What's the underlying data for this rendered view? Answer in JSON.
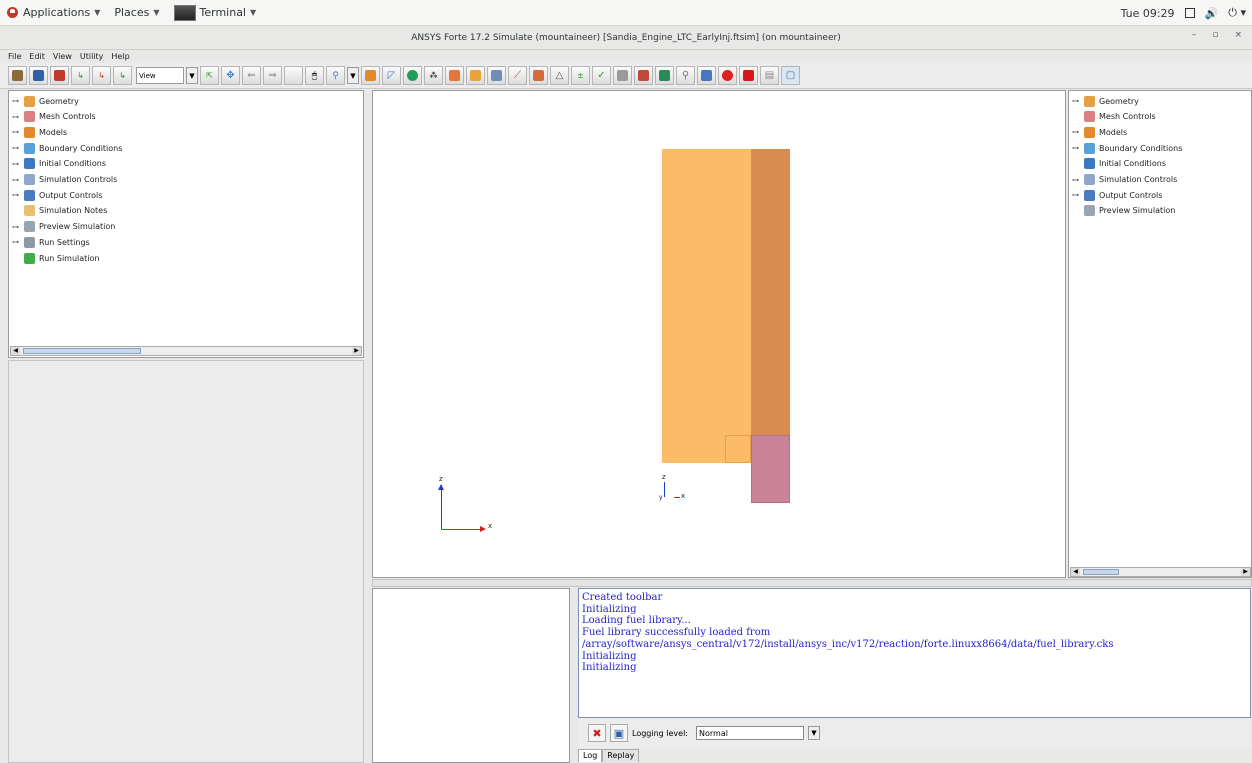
{
  "topbar": {
    "applications": "Applications",
    "places": "Places",
    "terminal": "Terminal",
    "clock": "Tue 09:29"
  },
  "window": {
    "title": "ANSYS Forte 17.2 Simulate (mountaineer)  [Sandia_Engine_LTC_EarlyInj.ftsim] (on mountaineer)"
  },
  "menu": [
    "File",
    "Edit",
    "View",
    "Utility",
    "Help"
  ],
  "toolbar": {
    "view_combo": "View"
  },
  "left_tree": [
    {
      "label": "Geometry",
      "icon_color": "#e6a044",
      "expandable": true
    },
    {
      "label": "Mesh Controls",
      "icon_color": "#d98080",
      "expandable": true
    },
    {
      "label": "Models",
      "icon_color": "#e08a2c",
      "expandable": true
    },
    {
      "label": "Boundary Conditions",
      "icon_color": "#5aa0d8",
      "expandable": true
    },
    {
      "label": "Initial Conditions",
      "icon_color": "#3b78c4",
      "expandable": true
    },
    {
      "label": "Simulation Controls",
      "icon_color": "#8fa7c8",
      "expandable": true
    },
    {
      "label": "Output Controls",
      "icon_color": "#4a7bbf",
      "expandable": true
    },
    {
      "label": "Simulation Notes",
      "icon_color": "#e8c070",
      "expandable": false
    },
    {
      "label": "Preview Simulation",
      "icon_color": "#9aa4b0",
      "expandable": true
    },
    {
      "label": "Run Settings",
      "icon_color": "#8f9aa8",
      "expandable": true
    },
    {
      "label": "Run Simulation",
      "icon_color": "#3fae49",
      "expandable": false
    }
  ],
  "right_tree": [
    {
      "label": "Geometry",
      "icon_color": "#e6a044",
      "expandable": true
    },
    {
      "label": "Mesh Controls",
      "icon_color": "#d98080",
      "expandable": false
    },
    {
      "label": "Models",
      "icon_color": "#e08a2c",
      "expandable": true
    },
    {
      "label": "Boundary Conditions",
      "icon_color": "#5aa0d8",
      "expandable": true
    },
    {
      "label": "Initial Conditions",
      "icon_color": "#3b78c4",
      "expandable": false
    },
    {
      "label": "Simulation Controls",
      "icon_color": "#8fa7c8",
      "expandable": true
    },
    {
      "label": "Output Controls",
      "icon_color": "#4a7bbf",
      "expandable": true
    },
    {
      "label": "Preview Simulation",
      "icon_color": "#9aa4b0",
      "expandable": false
    }
  ],
  "viewport": {
    "axis_z": "z",
    "axis_x": "x",
    "axis_y": "y",
    "colors": {
      "block_light": "#fdbb68",
      "block_dark": "#d98c4f",
      "block_pink": "#c98597"
    }
  },
  "log": {
    "lines": [
      "Created toolbar",
      "Initializing",
      "Loading fuel library...",
      "Fuel library successfully loaded from",
      "/array/software/ansys_central/v172/install/ansys_inc/v172/reaction/forte.linuxx8664/data/fuel_library.cks",
      "Initializing",
      "Initializing"
    ],
    "logging_level_label": "Logging level:",
    "logging_level_value": "Normal",
    "tabs": [
      "Log",
      "Replay"
    ]
  }
}
